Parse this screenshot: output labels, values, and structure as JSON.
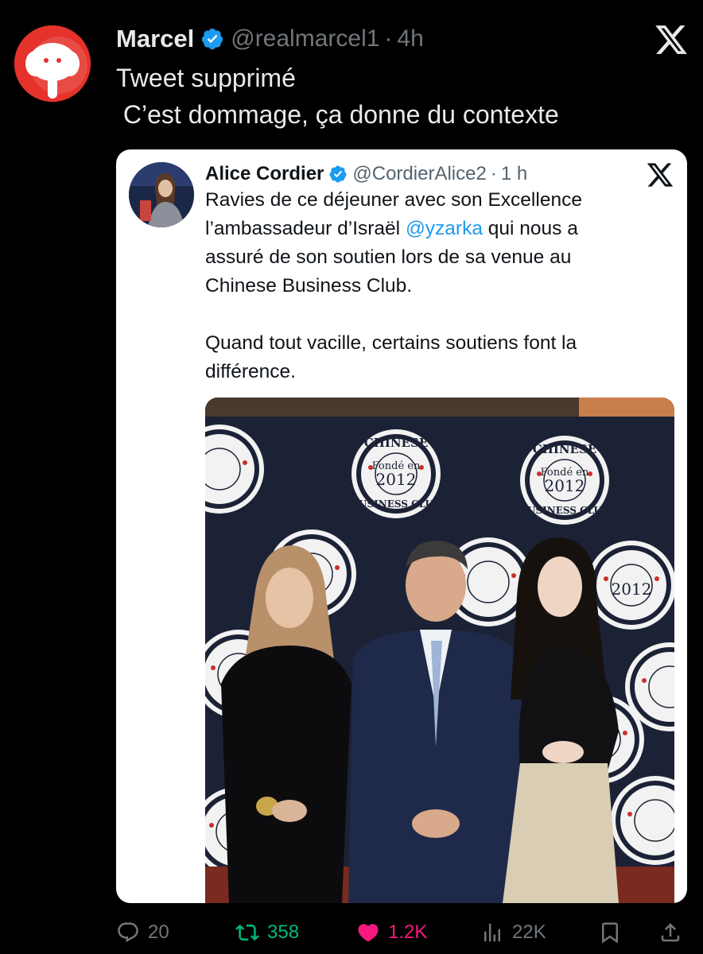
{
  "post": {
    "author_name": "Marcel",
    "author_handle": "@realmarcel1",
    "separator": "·",
    "time": "4h",
    "text_line1": "Tweet supprimé",
    "text_line2": " C’est dommage, ça donne du contexte"
  },
  "quoted": {
    "author_name": "Alice Cordier",
    "author_handle": "@CordierAlice2",
    "separator": "·",
    "time": "1 h",
    "lines": [
      "Ravies de ce déjeuner avec son Excellence",
      "l’ambassadeur d’Israël ",
      "@yzarka",
      " qui nous a",
      "assuré de son soutien lors de sa venue au",
      "Chinese Business Club.",
      "Quand tout vacille, certains soutiens font la",
      "différence."
    ],
    "photo_seal": {
      "top": "CHINESE",
      "founded": "Fondé en",
      "year": "2012",
      "bottom": "BUSINESS CLUB"
    }
  },
  "actions": {
    "replies": "20",
    "reposts": "358",
    "likes": "1.2K",
    "views": "22K"
  },
  "colors": {
    "background": "#000000",
    "verified": "#1d9bf0",
    "mention": "#1d9bf0",
    "repost": "#00ba7c",
    "like": "#f91880",
    "muted": "#71767b"
  },
  "icons": [
    "verified-badge-icon",
    "x-logo-icon",
    "reply-icon",
    "repost-icon",
    "like-icon",
    "views-icon",
    "bookmark-icon",
    "share-icon"
  ]
}
